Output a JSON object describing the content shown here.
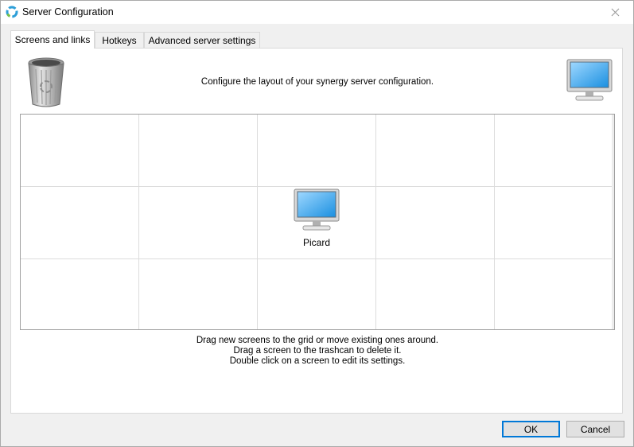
{
  "window": {
    "title": "Server Configuration",
    "app_icon": "synergy-logo-icon",
    "close_icon": "close-icon"
  },
  "tabs": [
    {
      "label": "Screens and links",
      "active": true
    },
    {
      "label": "Hotkeys",
      "active": false
    },
    {
      "label": "Advanced server settings",
      "active": false
    }
  ],
  "screens_tab": {
    "trash_icon": "trashcan-icon",
    "new_screen_icon": "monitor-icon",
    "configure_text": "Configure the layout of your synergy server configuration.",
    "grid": {
      "columns": 5,
      "rows": 3,
      "screens": [
        {
          "name": "Picard",
          "row": 1,
          "column": 2,
          "icon": "monitor-icon"
        }
      ]
    },
    "hints": [
      "Drag new screens to the grid or move existing ones around.",
      "Drag a screen to the trashcan to delete it.",
      "Double click on a screen to edit its settings."
    ]
  },
  "buttons": {
    "ok_label": "OK",
    "cancel_label": "Cancel"
  },
  "colors": {
    "accent": "#0078d7",
    "panel_background": "#ffffff",
    "window_background": "#f0f0f0"
  }
}
